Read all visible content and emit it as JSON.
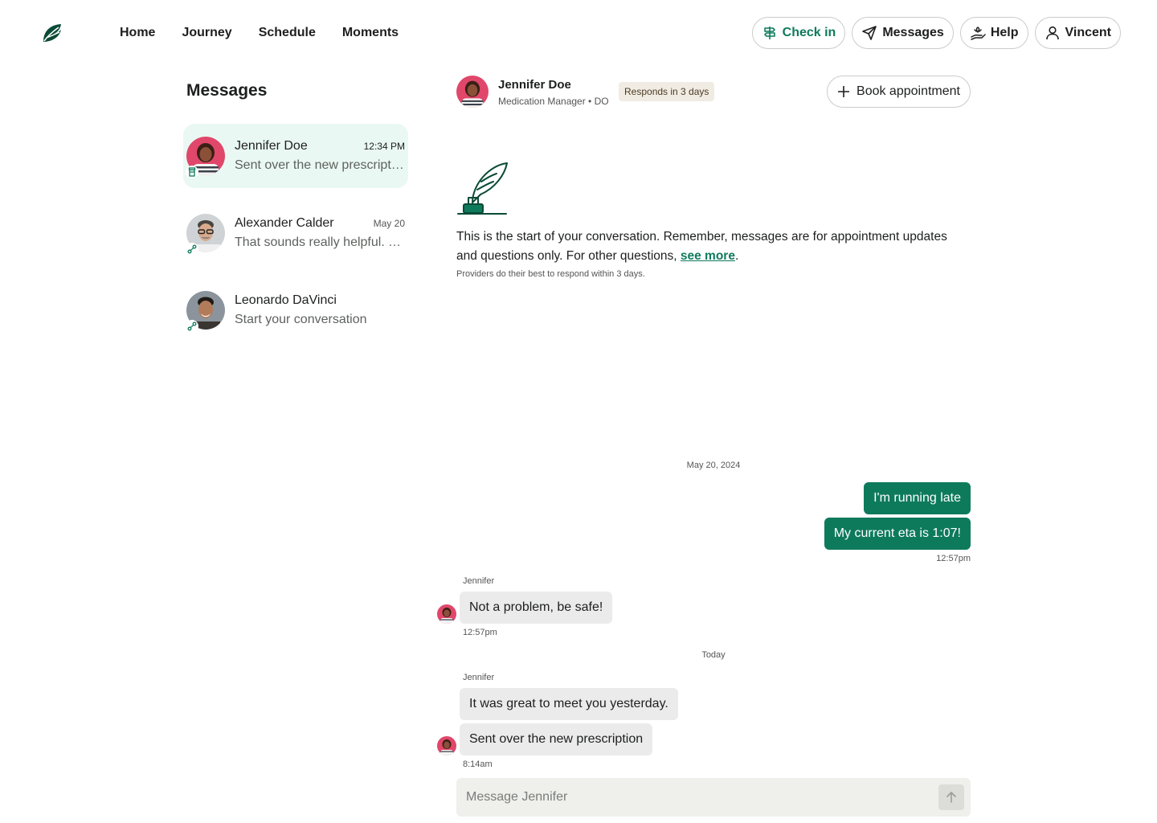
{
  "nav": {
    "links": [
      "Home",
      "Journey",
      "Schedule",
      "Moments"
    ],
    "check_in": "Check in",
    "messages": "Messages",
    "help": "Help",
    "user": "Vincent"
  },
  "sidebar": {
    "title": "Messages",
    "conversations": [
      {
        "name": "Jennifer Doe",
        "time": "12:34 PM",
        "preview": "Sent over the new prescription",
        "badge_icon": "pill-bottle-icon"
      },
      {
        "name": "Alexander Calder",
        "time": "May 20",
        "preview": "That sounds really helpful. Thanks!",
        "badge_icon": "link-icon"
      },
      {
        "name": "Leonardo DaVinci",
        "time": "",
        "preview": "Start your conversation",
        "badge_icon": "link-icon"
      }
    ]
  },
  "chat": {
    "name": "Jennifer Doe",
    "role": "Medication Manager • DO",
    "respond_badge": "Responds in 3 days",
    "book_label": "Book appointment",
    "intro_text": "This is the start of your conversation. Remember, messages are for appointment updates and questions only. For other questions, ",
    "intro_link": "see more",
    "intro_end": ".",
    "intro_sub": "Providers do their best to respond within 3 days.",
    "date_1": "May 20, 2024",
    "out_1": "I'm running late",
    "out_2": "My current eta is 1:07!",
    "out_time": "12:57pm",
    "sender_1": "Jennifer",
    "in_1": "Not a problem, be safe!",
    "in_1_time": "12:57pm",
    "date_2": "Today",
    "sender_2": "Jennifer",
    "in_2": "It was great to meet you yesterday.",
    "in_3": "Sent over the new prescription",
    "in_3_time": "8:14am",
    "composer_placeholder": "Message Jennifer"
  },
  "colors": {
    "accent": "#0e7a5c",
    "active_row": "#eaf8f3",
    "badge_bg": "#f1ece3"
  }
}
